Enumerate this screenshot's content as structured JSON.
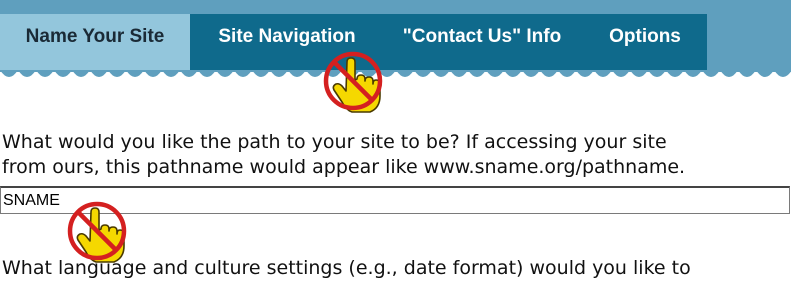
{
  "tabs": [
    {
      "label": "Name Your Site",
      "active": true
    },
    {
      "label": "Site Navigation",
      "active": false
    },
    {
      "label": "\"Contact Us\" Info",
      "active": false
    },
    {
      "label": "Options",
      "active": false
    }
  ],
  "colors": {
    "band": "#5f9fbe",
    "tab_strip": "#0f6a8c",
    "active_tab": "#93c6dc",
    "no_click_ring": "#d42020",
    "hand": "#f5d800"
  },
  "path_question": {
    "line1": "What would you like the path to your site to be? If accessing your site",
    "line2": "from ours, this pathname would appear like www.sname.org/pathname."
  },
  "path_input": {
    "value": "SNAME"
  },
  "language_question": {
    "line1": "What language and culture settings (e.g., date format) would you like to"
  },
  "icons": [
    "no-click-hand-icon",
    "no-click-hand-icon"
  ]
}
